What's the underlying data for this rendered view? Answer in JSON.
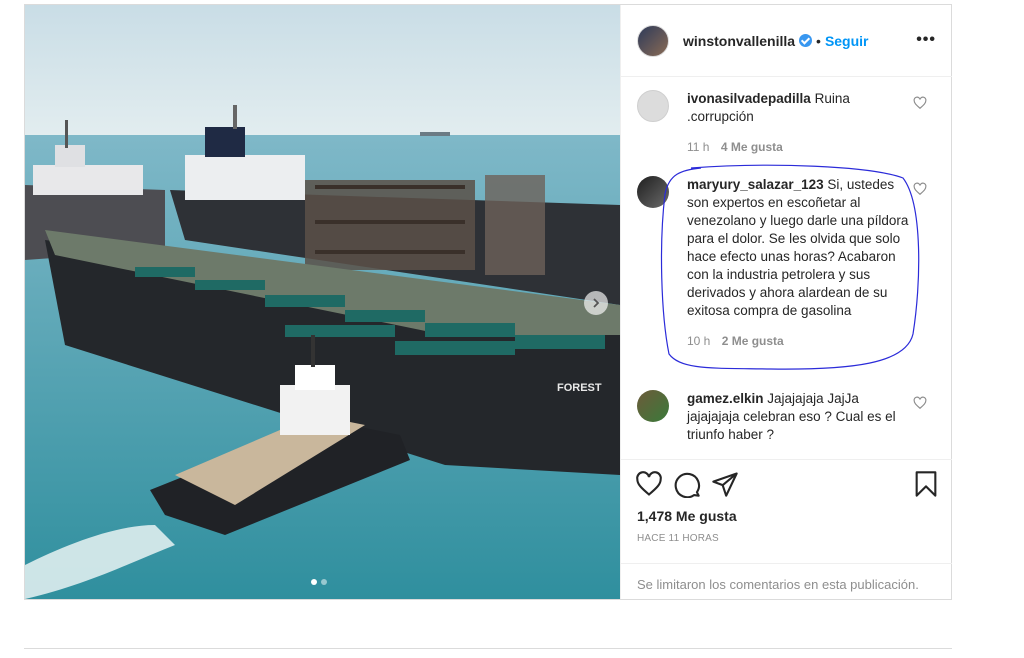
{
  "post": {
    "author": "winstonvallenilla",
    "separator": "•",
    "follow_label": "Seguir",
    "more_label": "•••"
  },
  "image": {
    "description_label": "Forest",
    "hull_text": "FOREST"
  },
  "comments": [
    {
      "user": "ivonasilvadepadilla",
      "text": "Ruina .corrupción",
      "time": "11 h",
      "likes": "4 Me gusta"
    },
    {
      "user": "maryury_salazar_123",
      "text": "Si, ustedes son expertos en escoñetar al venezolano y luego darle una píldora para el dolor. Se les olvida que solo hace efecto unas horas? Acabaron con la industria petrolera y sus derivados y ahora alardean de su exitosa compra de gasolina",
      "time": "10 h",
      "likes": "2 Me gusta"
    },
    {
      "user": "gamez.elkin",
      "text": "Jajajajaja JajJa jajajajaja celebran eso ? Cual es el triunfo haber ?",
      "time": "",
      "likes": ""
    }
  ],
  "actions": {
    "like_count": "1,478 Me gusta",
    "timestamp": "HACE 11 HORAS",
    "comments_limited": "Se limitaron los comentarios en esta publicación."
  },
  "colors": {
    "accent": "#0095f6",
    "annotation": "#2b2bd9",
    "muted": "#8e8e8e"
  }
}
